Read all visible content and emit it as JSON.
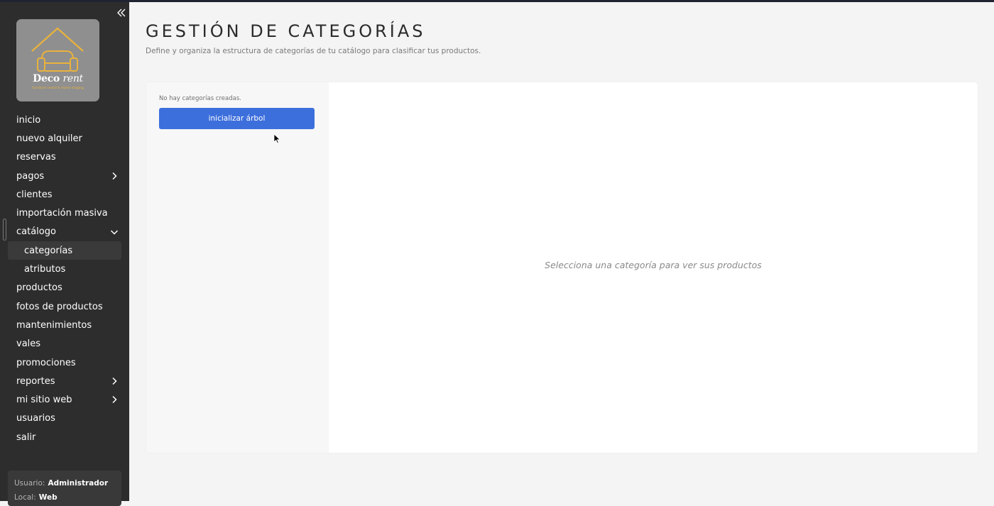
{
  "sidebar": {
    "logo": {
      "brand": "Deco",
      "brand_italic": "rent",
      "tagline": "Furniture rental & Home staging"
    },
    "items": [
      {
        "label": "inicio"
      },
      {
        "label": "nuevo alquiler"
      },
      {
        "label": "reservas"
      },
      {
        "label": "pagos",
        "chevron": "chevron-right-icon"
      },
      {
        "label": "clientes"
      },
      {
        "label": "importación masiva"
      },
      {
        "label": "catálogo",
        "chevron": "chevron-down-icon",
        "expanded": true,
        "children": [
          {
            "label": "categorías",
            "active": true
          },
          {
            "label": "atributos"
          }
        ]
      },
      {
        "label": "productos"
      },
      {
        "label": "fotos de productos"
      },
      {
        "label": "mantenimientos"
      },
      {
        "label": "vales"
      },
      {
        "label": "promociones"
      },
      {
        "label": "reportes",
        "chevron": "chevron-right-icon"
      },
      {
        "label": "mi sitio web",
        "chevron": "chevron-right-icon"
      },
      {
        "label": "usuarios"
      },
      {
        "label": "salir"
      }
    ],
    "user": {
      "user_label": "Usuario:",
      "user_value": "Administrador",
      "local_label": "Local:",
      "local_value": "Web"
    }
  },
  "header": {
    "title": "GESTIÓN DE CATEGORÍAS",
    "subtitle": "Define y organiza la estructura de categorías de tu catálogo para clasificar tus productos."
  },
  "tree": {
    "empty_message": "No hay categorías creadas.",
    "init_button": "inicializar árbol"
  },
  "products": {
    "placeholder": "Selecciona una categoría para ver sus productos"
  },
  "colors": {
    "sidebar_bg": "#2d2d2d",
    "accent": "#3d6fdc",
    "logo_orange": "#e9b23c"
  }
}
